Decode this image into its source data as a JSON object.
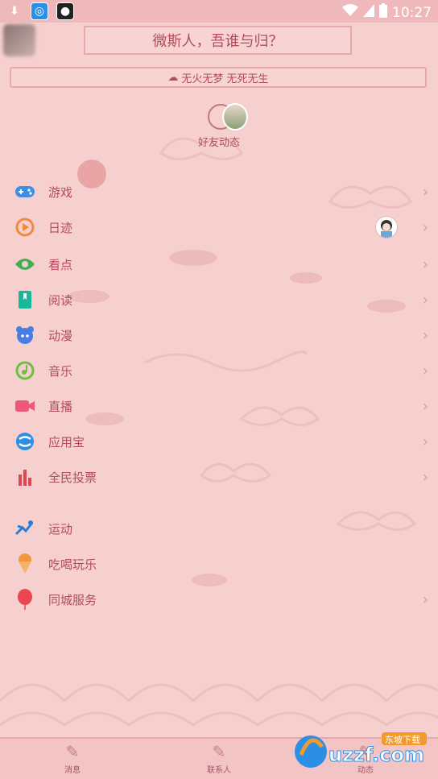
{
  "status_bar": {
    "time": "10:27",
    "left_icons": [
      "download-icon",
      "app-icon",
      "camera-icon"
    ],
    "right_icons": [
      "wifi-icon",
      "signal-icon",
      "battery-icon"
    ]
  },
  "header": {
    "title": "微斯人，吾谁与归？",
    "motto": "无火无梦 无死无生"
  },
  "friends": {
    "label": "好友动态"
  },
  "menu": {
    "items": [
      {
        "label": "游戏",
        "icon": "gamepad-icon",
        "color": "#3a8fe6"
      },
      {
        "label": "日迹",
        "icon": "daily-record-icon",
        "color": "#f08a3c"
      },
      {
        "label": "看点",
        "icon": "eye-icon",
        "color": "#3fb04f"
      },
      {
        "label": "阅读",
        "icon": "book-icon",
        "color": "#19b79a"
      },
      {
        "label": "动漫",
        "icon": "anime-icon",
        "color": "#4a7de2"
      },
      {
        "label": "音乐",
        "icon": "music-icon",
        "color": "#6cbf3f"
      },
      {
        "label": "直播",
        "icon": "live-camera-icon",
        "color": "#f0557a"
      },
      {
        "label": "应用宝",
        "icon": "app-store-icon",
        "color": "#2c8fe6"
      },
      {
        "label": "全民投票",
        "icon": "vote-chart-icon",
        "color": "#e2454f"
      },
      {
        "label": "运动",
        "icon": "sport-icon",
        "color": "#2b7fd8"
      },
      {
        "label": "吃喝玩乐",
        "icon": "ice-cream-icon",
        "color": "#f0993c"
      },
      {
        "label": "同城服务",
        "icon": "balloon-icon",
        "color": "#e94750"
      }
    ]
  },
  "tabbar": {
    "tabs": [
      {
        "label": "消息"
      },
      {
        "label": "联系人"
      },
      {
        "label": "动态"
      }
    ]
  },
  "watermark": {
    "text": "uzzf.com",
    "sub": "东坡下载"
  }
}
